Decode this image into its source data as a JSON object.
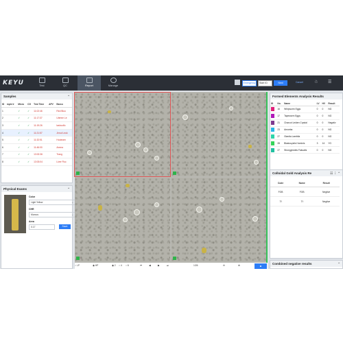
{
  "topbar": {
    "logo": "KEYU",
    "nav": [
      {
        "label": "Test",
        "active": false
      },
      {
        "label": "QC",
        "active": false
      },
      {
        "label": "Report",
        "active": true
      },
      {
        "label": "Manage",
        "active": false
      }
    ],
    "emergency_label": "Emergency",
    "start_id_value": "Start ID",
    "next_label": "Next",
    "cancel_label": "Cancel"
  },
  "samples": {
    "title": "Samples",
    "columns": [
      "ID",
      "mple Ir",
      "Micro",
      "CG",
      "Test Time",
      "APV",
      "Barco"
    ],
    "rows": [
      {
        "id": "1",
        "time": "11:02:46",
        "barcode": "Red Bloo",
        "red": true
      },
      {
        "id": "2",
        "time": "11:17:37",
        "barcode": "Uterine Le",
        "red": true
      },
      {
        "id": "3",
        "time": "11:19:26",
        "barcode": "lashcolfo",
        "red": true
      },
      {
        "id": "4",
        "time": "11:21:57",
        "barcode": "Jerod Leuk",
        "red": true
      },
      {
        "id": "5",
        "time": "11:32:51",
        "barcode": "Houteam",
        "red": true
      },
      {
        "id": "6",
        "time": "11:46:00",
        "barcode": "Amma",
        "red": true
      },
      {
        "id": "7",
        "time": "13:02:36",
        "barcode": "Trang",
        "red": true
      },
      {
        "id": "8",
        "time": "13:03:04",
        "barcode": "Liver Fluc",
        "red": true
      }
    ]
  },
  "physical": {
    "title": "Physical Exams",
    "color_label": "Color",
    "color_value": "Light Yellow",
    "chr_label": "CHR",
    "chr_value": "Murous",
    "area_label": "Area",
    "area_value": "0.17",
    "save_label": "Save"
  },
  "controls": {
    "lp": "LP",
    "hp": "HP",
    "zoom_options": [
      "2",
      "4",
      "6"
    ],
    "page": "1/26"
  },
  "formed": {
    "title": "Formed Elements Analysis Results",
    "columns": [
      "ID",
      "No.",
      "Name",
      "LV",
      "HV",
      "Result"
    ],
    "rows": [
      {
        "no": "16",
        "name": "Whipworm Eggs",
        "lv": "0",
        "hv": "0",
        "result": "NG",
        "color": "#e0207a"
      },
      {
        "no": "17",
        "name": "Tapeworm Eggs",
        "lv": "0",
        "hv": "0",
        "result": "NG",
        "color": "#b01ab8"
      },
      {
        "no": "21",
        "name": "Charcot Leiden Crystal",
        "lv": "0",
        "hv": "0",
        "result": "Negativ",
        "color": "#7e3a8f"
      },
      {
        "no": "23",
        "name": "Amoeba",
        "lv": "0",
        "hv": "0",
        "result": "NG",
        "color": "#29b7e6"
      },
      {
        "no": "27",
        "name": "Giardia Lamblia",
        "lv": "0",
        "hv": "0",
        "result": "NG",
        "color": "#2dd4a8"
      },
      {
        "no": "28",
        "name": "Blastocystis Hominis",
        "lv": "3",
        "hv": "14",
        "result": "YG",
        "color": "#35d35a"
      },
      {
        "no": "27",
        "name": "Strongyloides Fakualis",
        "lv": "0",
        "hv": "0",
        "result": "NG",
        "color": "#20c0a0"
      }
    ]
  },
  "colloidal": {
    "title": "Colloidal Gold Analysis Re",
    "columns": [
      "Code",
      "Name",
      "Result"
    ],
    "rows": [
      {
        "code": "FOB",
        "name": "FOB",
        "result": "Negtive"
      },
      {
        "code": "Tf",
        "name": "Tf",
        "result": "Negtive"
      }
    ]
  },
  "combined": {
    "title": "Combined negative results"
  }
}
